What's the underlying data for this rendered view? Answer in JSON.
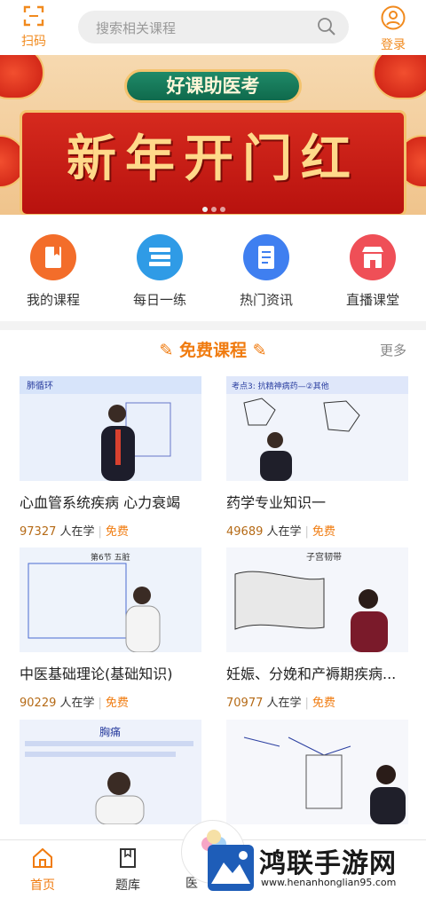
{
  "header": {
    "scan_label": "扫码",
    "search_placeholder": "搜索相关课程",
    "login_label": "登录"
  },
  "banner": {
    "ribbon_text": "好课助医考",
    "title": "新年开门红",
    "slide_count": 3,
    "active_slide": 1
  },
  "quicknav": [
    {
      "label": "我的课程",
      "icon": "bookmark-book-icon",
      "color": "#f36d2a"
    },
    {
      "label": "每日一练",
      "icon": "books-icon",
      "color": "#2f9be6"
    },
    {
      "label": "热门资讯",
      "icon": "document-icon",
      "color": "#3f7ff0"
    },
    {
      "label": "直播课堂",
      "icon": "store-icon",
      "color": "#ef4f57"
    }
  ],
  "section": {
    "title": "免费课程",
    "more_label": "更多"
  },
  "courses": [
    {
      "title": "心血管系统疾病  心力衰竭",
      "students": "97327",
      "suffix": "人在学",
      "price": "免费"
    },
    {
      "title": "药学专业知识一",
      "students": "49689",
      "suffix": "人在学",
      "price": "免费"
    },
    {
      "title": "中医基础理论(基础知识)",
      "students": "90229",
      "suffix": "人在学",
      "price": "免费"
    },
    {
      "title": "妊娠、分娩和产褥期疾病...",
      "students": "70977",
      "suffix": "人在学",
      "price": "免费"
    },
    {
      "title": "",
      "students": "",
      "suffix": "",
      "price": ""
    },
    {
      "title": "",
      "students": "",
      "suffix": "",
      "price": ""
    }
  ],
  "thumb_texts": {
    "t1": "肺循环",
    "t2": "考点3: 抗精神病药—②其他",
    "t3": "第6节 五脏",
    "t4": "子宫韧带",
    "t5": "胸痛"
  },
  "tabbar": {
    "home": "首页",
    "questions": "题库",
    "third_partial": "医"
  },
  "watermark": {
    "name": "鸿联手游网",
    "url": "www.henanhonglian95.com"
  },
  "colors": {
    "accent": "#f07b0f",
    "brand_orange": "#f18a1e"
  }
}
